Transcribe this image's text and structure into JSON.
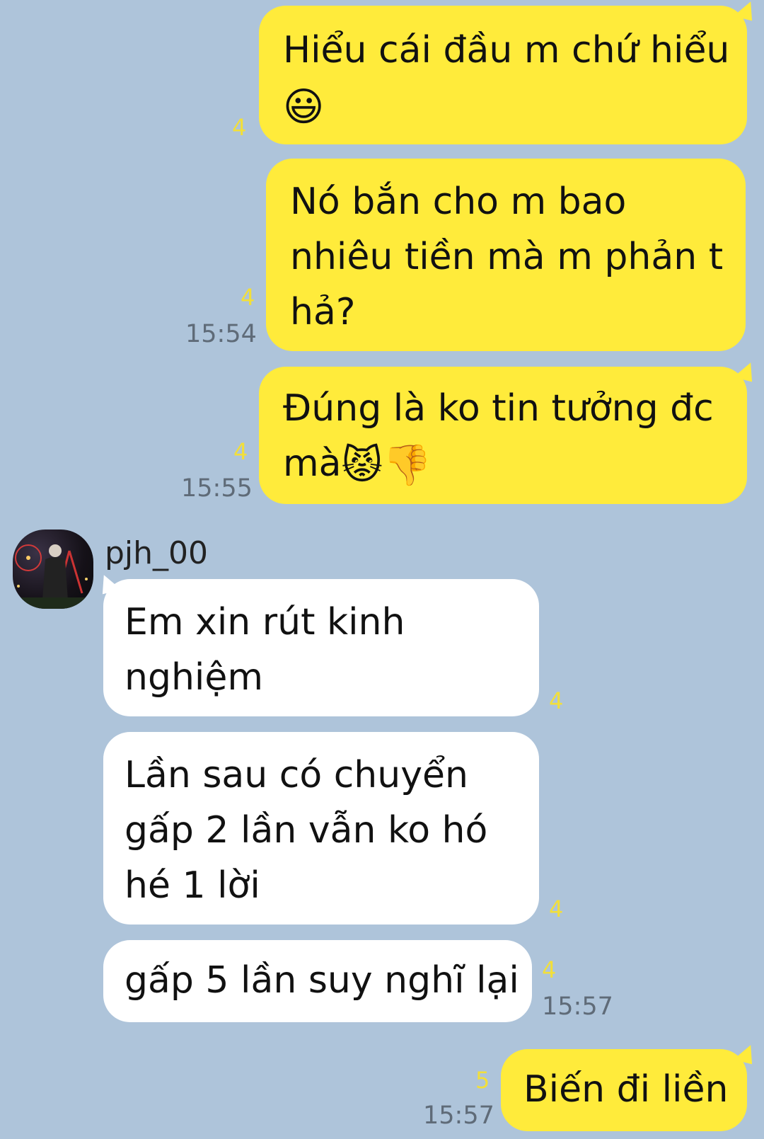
{
  "colors": {
    "background": "#aec4da",
    "outgoing_bubble": "#ffeb3b",
    "incoming_bubble": "#ffffff",
    "read_count": "#f2df3a",
    "timestamp": "#5f6b78"
  },
  "messages": [
    {
      "direction": "out",
      "text": "Hiểu cái đầu m chứ hiểu",
      "emoji": "😃",
      "read_count": "4",
      "time": ""
    },
    {
      "direction": "out",
      "text": "Nó bắn cho m bao nhiêu tiền mà m phản t hả?",
      "emoji": "",
      "read_count": "4",
      "time": "15:54"
    },
    {
      "direction": "out",
      "text": "Đúng là ko tin tưởng đc mà",
      "emoji": "😾👎",
      "read_count": "4",
      "time": "15:55"
    },
    {
      "direction": "in",
      "sender": "pjh_00",
      "text": "Em xin rút kinh nghiệm",
      "read_count": "4",
      "time": ""
    },
    {
      "direction": "in",
      "text": "Lần sau có chuyển gấp 2 lần vẫn ko hó hé 1 lời",
      "read_count": "4",
      "time": ""
    },
    {
      "direction": "in",
      "text": "gấp 5 lần suy nghĩ lại",
      "read_count": "4",
      "time": "15:57"
    },
    {
      "direction": "out",
      "text": "Biến đi liền",
      "emoji": "",
      "read_count": "5",
      "time": "15:57"
    }
  ]
}
